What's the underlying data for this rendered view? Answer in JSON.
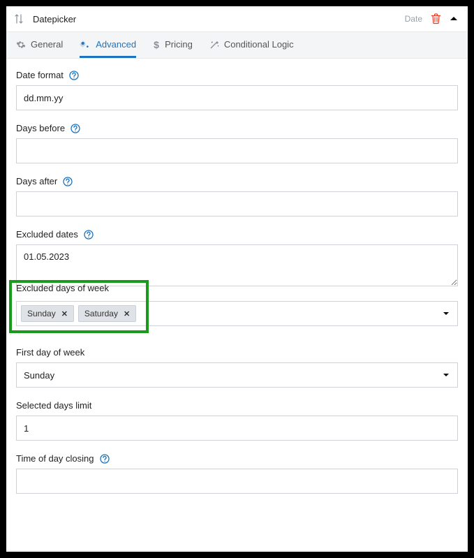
{
  "header": {
    "title": "Datepicker",
    "type_label": "Date"
  },
  "tabs": {
    "general": "General",
    "advanced": "Advanced",
    "pricing": "Pricing",
    "conditional": "Conditional Logic"
  },
  "fields": {
    "date_format": {
      "label": "Date format",
      "value": "dd.mm.yy"
    },
    "days_before": {
      "label": "Days before",
      "value": ""
    },
    "days_after": {
      "label": "Days after",
      "value": ""
    },
    "excluded_dates": {
      "label": "Excluded dates",
      "value": "01.05.2023"
    },
    "excluded_days_of_week": {
      "label": "Excluded days of week",
      "chips": [
        "Sunday",
        "Saturday"
      ]
    },
    "first_day_of_week": {
      "label": "First day of week",
      "value": "Sunday"
    },
    "selected_days_limit": {
      "label": "Selected days limit",
      "value": "1"
    },
    "time_of_day_closing": {
      "label": "Time of day closing",
      "value": ""
    }
  }
}
